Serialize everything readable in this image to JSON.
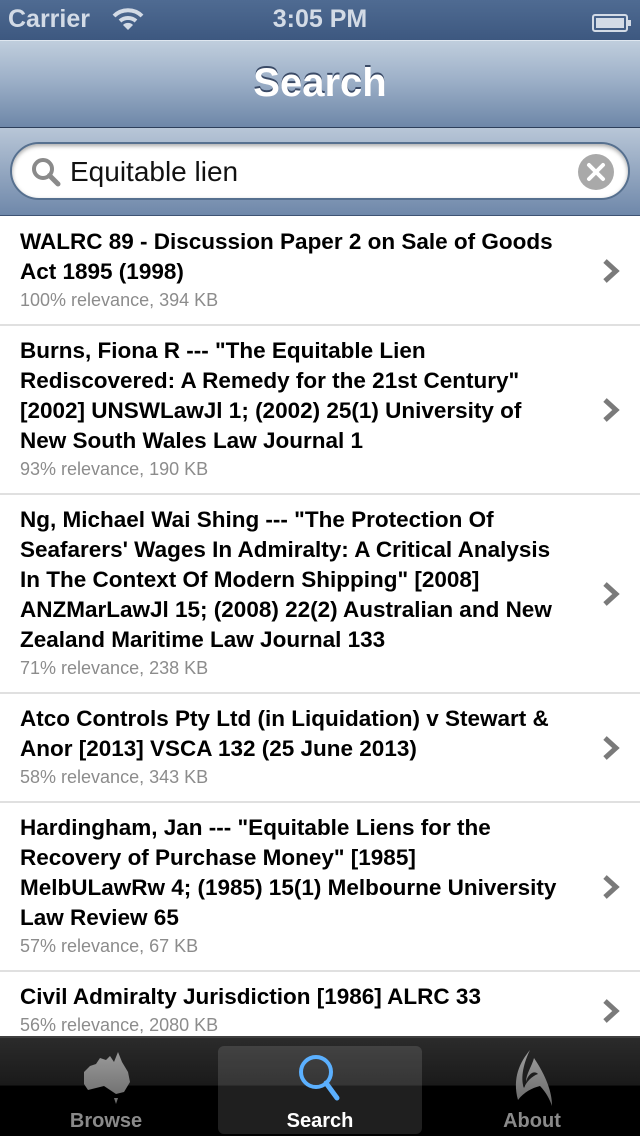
{
  "status_bar": {
    "carrier": "Carrier",
    "time": "3:05 PM",
    "wifi_icon": "wifi-icon",
    "battery_icon": "battery-icon"
  },
  "nav_bar": {
    "title": "Search"
  },
  "search": {
    "value": "Equitable lien",
    "search_icon": "magnifier-icon",
    "clear_icon": "clear-x-icon"
  },
  "results": [
    {
      "title": "WALRC 89 - Discussion Paper 2 on Sale of Goods Act 1895 (1998)",
      "meta": "100% relevance, 394 KB"
    },
    {
      "title": "Burns, Fiona R --- \"The Equitable Lien Rediscovered: A Remedy for the 21st Century\" [2002] UNSWLawJl 1; (2002) 25(1) University of New South Wales Law Journal 1",
      "meta": "93% relevance, 190 KB"
    },
    {
      "title": "Ng, Michael Wai Shing --- \"The Protection Of Seafarers' Wages In Admiralty: A Critical Analysis In The Context Of Modern Shipping\" [2008] ANZMarLawJl 15; (2008) 22(2) Australian and New Zealand Maritime Law Journal 133",
      "meta": "71% relevance, 238 KB"
    },
    {
      "title": "Atco Controls Pty Ltd (in Liquidation) v Stewart &  Anor [2013] VSCA 132 (25 June 2013)",
      "meta": "58% relevance, 343 KB"
    },
    {
      "title": "Hardingham, Jan --- \"Equitable Liens for the Recovery of Purchase Money\" [1985] MelbULawRw 4; (1985) 15(1) Melbourne University Law Review 65",
      "meta": "57% relevance, 67 KB"
    },
    {
      "title": "Civil Admiralty Jurisdiction [1986] ALRC 33",
      "meta": "56% relevance, 2080 KB"
    }
  ],
  "tab_bar": {
    "tabs": [
      {
        "label": "Browse",
        "icon": "australia-map-icon",
        "selected": false
      },
      {
        "label": "Search",
        "icon": "magnifier-icon",
        "selected": true
      },
      {
        "label": "About",
        "icon": "austlii-logo-icon",
        "selected": false
      }
    ]
  },
  "colors": {
    "nav_bar_top": "#c0cedd",
    "nav_bar_bottom": "#6e87a8",
    "status_bar": "#3d5880",
    "meta_text": "#8c8c8c",
    "chevron": "#7a7a7a",
    "tab_selected_icon": "#4aa3ff"
  }
}
